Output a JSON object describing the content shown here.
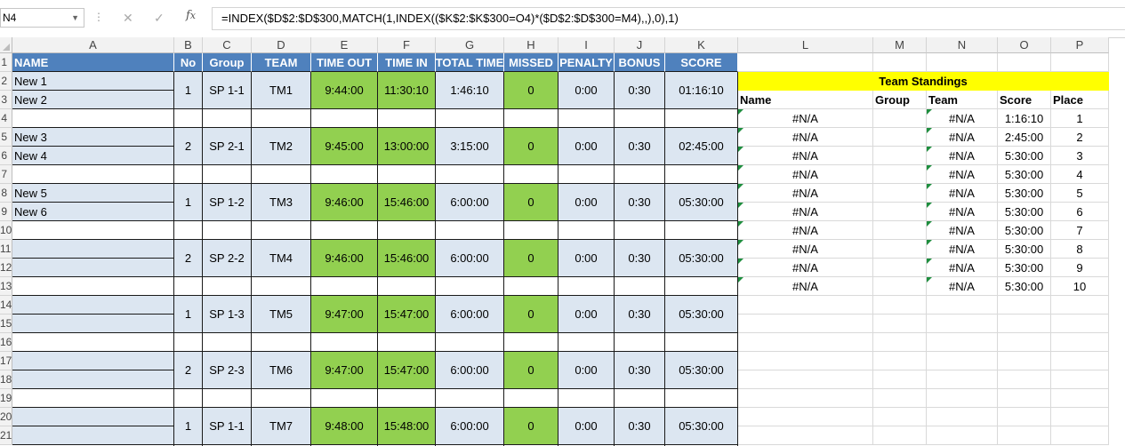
{
  "formula_bar": {
    "name_box": "N4",
    "formula": "=INDEX($D$2:$D$300,MATCH(1,INDEX(($K$2:$K$300=O4)*($D$2:$D$300=M4),,),0),1)"
  },
  "columns": [
    "A",
    "B",
    "C",
    "D",
    "E",
    "F",
    "G",
    "H",
    "I",
    "J",
    "K",
    "L",
    "M",
    "N",
    "O",
    "P"
  ],
  "row_numbers": [
    "1",
    "2",
    "3",
    "4",
    "5",
    "6",
    "7",
    "8",
    "9",
    "10",
    "11",
    "12",
    "13",
    "14",
    "15",
    "16",
    "17",
    "18",
    "19",
    "20",
    "21"
  ],
  "header": [
    "NAME",
    "No",
    "Group",
    "TEAM",
    "TIME OUT",
    "TIME IN",
    "TOTAL TIME",
    "MISSED",
    "PENALTY",
    "BONUS",
    "SCORE"
  ],
  "teams": [
    {
      "names": [
        "New 1",
        "New 2"
      ],
      "no": "1",
      "group": "SP 1-1",
      "team": "TM1",
      "time_out": "9:44:00",
      "time_in": "11:30:10",
      "total": "1:46:10",
      "missed": "0",
      "penalty": "0:00",
      "bonus": "0:30",
      "score": "01:16:10"
    },
    {
      "names": [
        "New 3",
        "New 4"
      ],
      "no": "2",
      "group": "SP 2-1",
      "team": "TM2",
      "time_out": "9:45:00",
      "time_in": "13:00:00",
      "total": "3:15:00",
      "missed": "0",
      "penalty": "0:00",
      "bonus": "0:30",
      "score": "02:45:00"
    },
    {
      "names": [
        "New 5",
        "New 6"
      ],
      "no": "1",
      "group": "SP 1-2",
      "team": "TM3",
      "time_out": "9:46:00",
      "time_in": "15:46:00",
      "total": "6:00:00",
      "missed": "0",
      "penalty": "0:00",
      "bonus": "0:30",
      "score": "05:30:00"
    },
    {
      "names": [
        "",
        ""
      ],
      "no": "2",
      "group": "SP 2-2",
      "team": "TM4",
      "time_out": "9:46:00",
      "time_in": "15:46:00",
      "total": "6:00:00",
      "missed": "0",
      "penalty": "0:00",
      "bonus": "0:30",
      "score": "05:30:00"
    },
    {
      "names": [
        "",
        ""
      ],
      "no": "1",
      "group": "SP 1-3",
      "team": "TM5",
      "time_out": "9:47:00",
      "time_in": "15:47:00",
      "total": "6:00:00",
      "missed": "0",
      "penalty": "0:00",
      "bonus": "0:30",
      "score": "05:30:00"
    },
    {
      "names": [
        "",
        ""
      ],
      "no": "2",
      "group": "SP 2-3",
      "team": "TM6",
      "time_out": "9:47:00",
      "time_in": "15:47:00",
      "total": "6:00:00",
      "missed": "0",
      "penalty": "0:00",
      "bonus": "0:30",
      "score": "05:30:00"
    },
    {
      "names": [
        "",
        ""
      ],
      "no": "1",
      "group": "SP 1-1",
      "team": "TM7",
      "time_out": "9:48:00",
      "time_in": "15:48:00",
      "total": "6:00:00",
      "missed": "0",
      "penalty": "0:00",
      "bonus": "0:30",
      "score": "05:30:00"
    }
  ],
  "standings": {
    "title": "Team Standings",
    "headers": [
      "Name",
      "Group",
      "Team",
      "Score",
      "Place"
    ],
    "rows": [
      {
        "name": "#N/A",
        "team": "#N/A",
        "score": "1:16:10",
        "place": "1"
      },
      {
        "name": "#N/A",
        "team": "#N/A",
        "score": "2:45:00",
        "place": "2"
      },
      {
        "name": "#N/A",
        "team": "#N/A",
        "score": "5:30:00",
        "place": "3"
      },
      {
        "name": "#N/A",
        "team": "#N/A",
        "score": "5:30:00",
        "place": "4"
      },
      {
        "name": "#N/A",
        "team": "#N/A",
        "score": "5:30:00",
        "place": "5"
      },
      {
        "name": "#N/A",
        "team": "#N/A",
        "score": "5:30:00",
        "place": "6"
      },
      {
        "name": "#N/A",
        "team": "#N/A",
        "score": "5:30:00",
        "place": "7"
      },
      {
        "name": "#N/A",
        "team": "#N/A",
        "score": "5:30:00",
        "place": "8"
      },
      {
        "name": "#N/A",
        "team": "#N/A",
        "score": "5:30:00",
        "place": "9"
      },
      {
        "name": "#N/A",
        "team": "#N/A",
        "score": "5:30:00",
        "place": "10"
      }
    ]
  },
  "colors": {
    "header_blue": "#4f81bd",
    "light_blue": "#dce6f1",
    "green": "#92d050",
    "yellow": "#ffff00"
  }
}
